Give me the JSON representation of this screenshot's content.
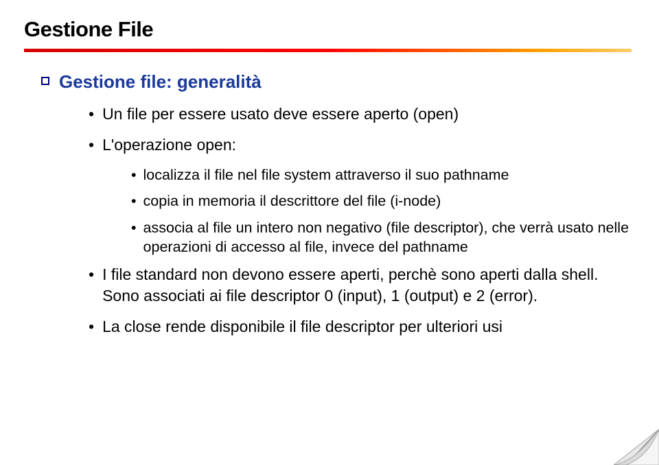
{
  "title": "Gestione File",
  "heading": "Gestione file: generalità",
  "items": [
    "Un file per essere usato deve essere aperto (open)",
    "L'operazione open:",
    "I file standard non devono essere aperti, perchè sono aperti dalla shell. Sono associati ai file descriptor 0 (input), 1 (output) e 2 (error).",
    "La close rende disponibile il file descriptor per ulteriori usi"
  ],
  "subitems": [
    "localizza il file nel file system attraverso il suo pathname",
    "copia in memoria il descrittore del file (i-node)",
    "associa al file un intero non negativo (file descriptor), che verrà usato nelle operazioni di accesso al file, invece del pathname"
  ]
}
